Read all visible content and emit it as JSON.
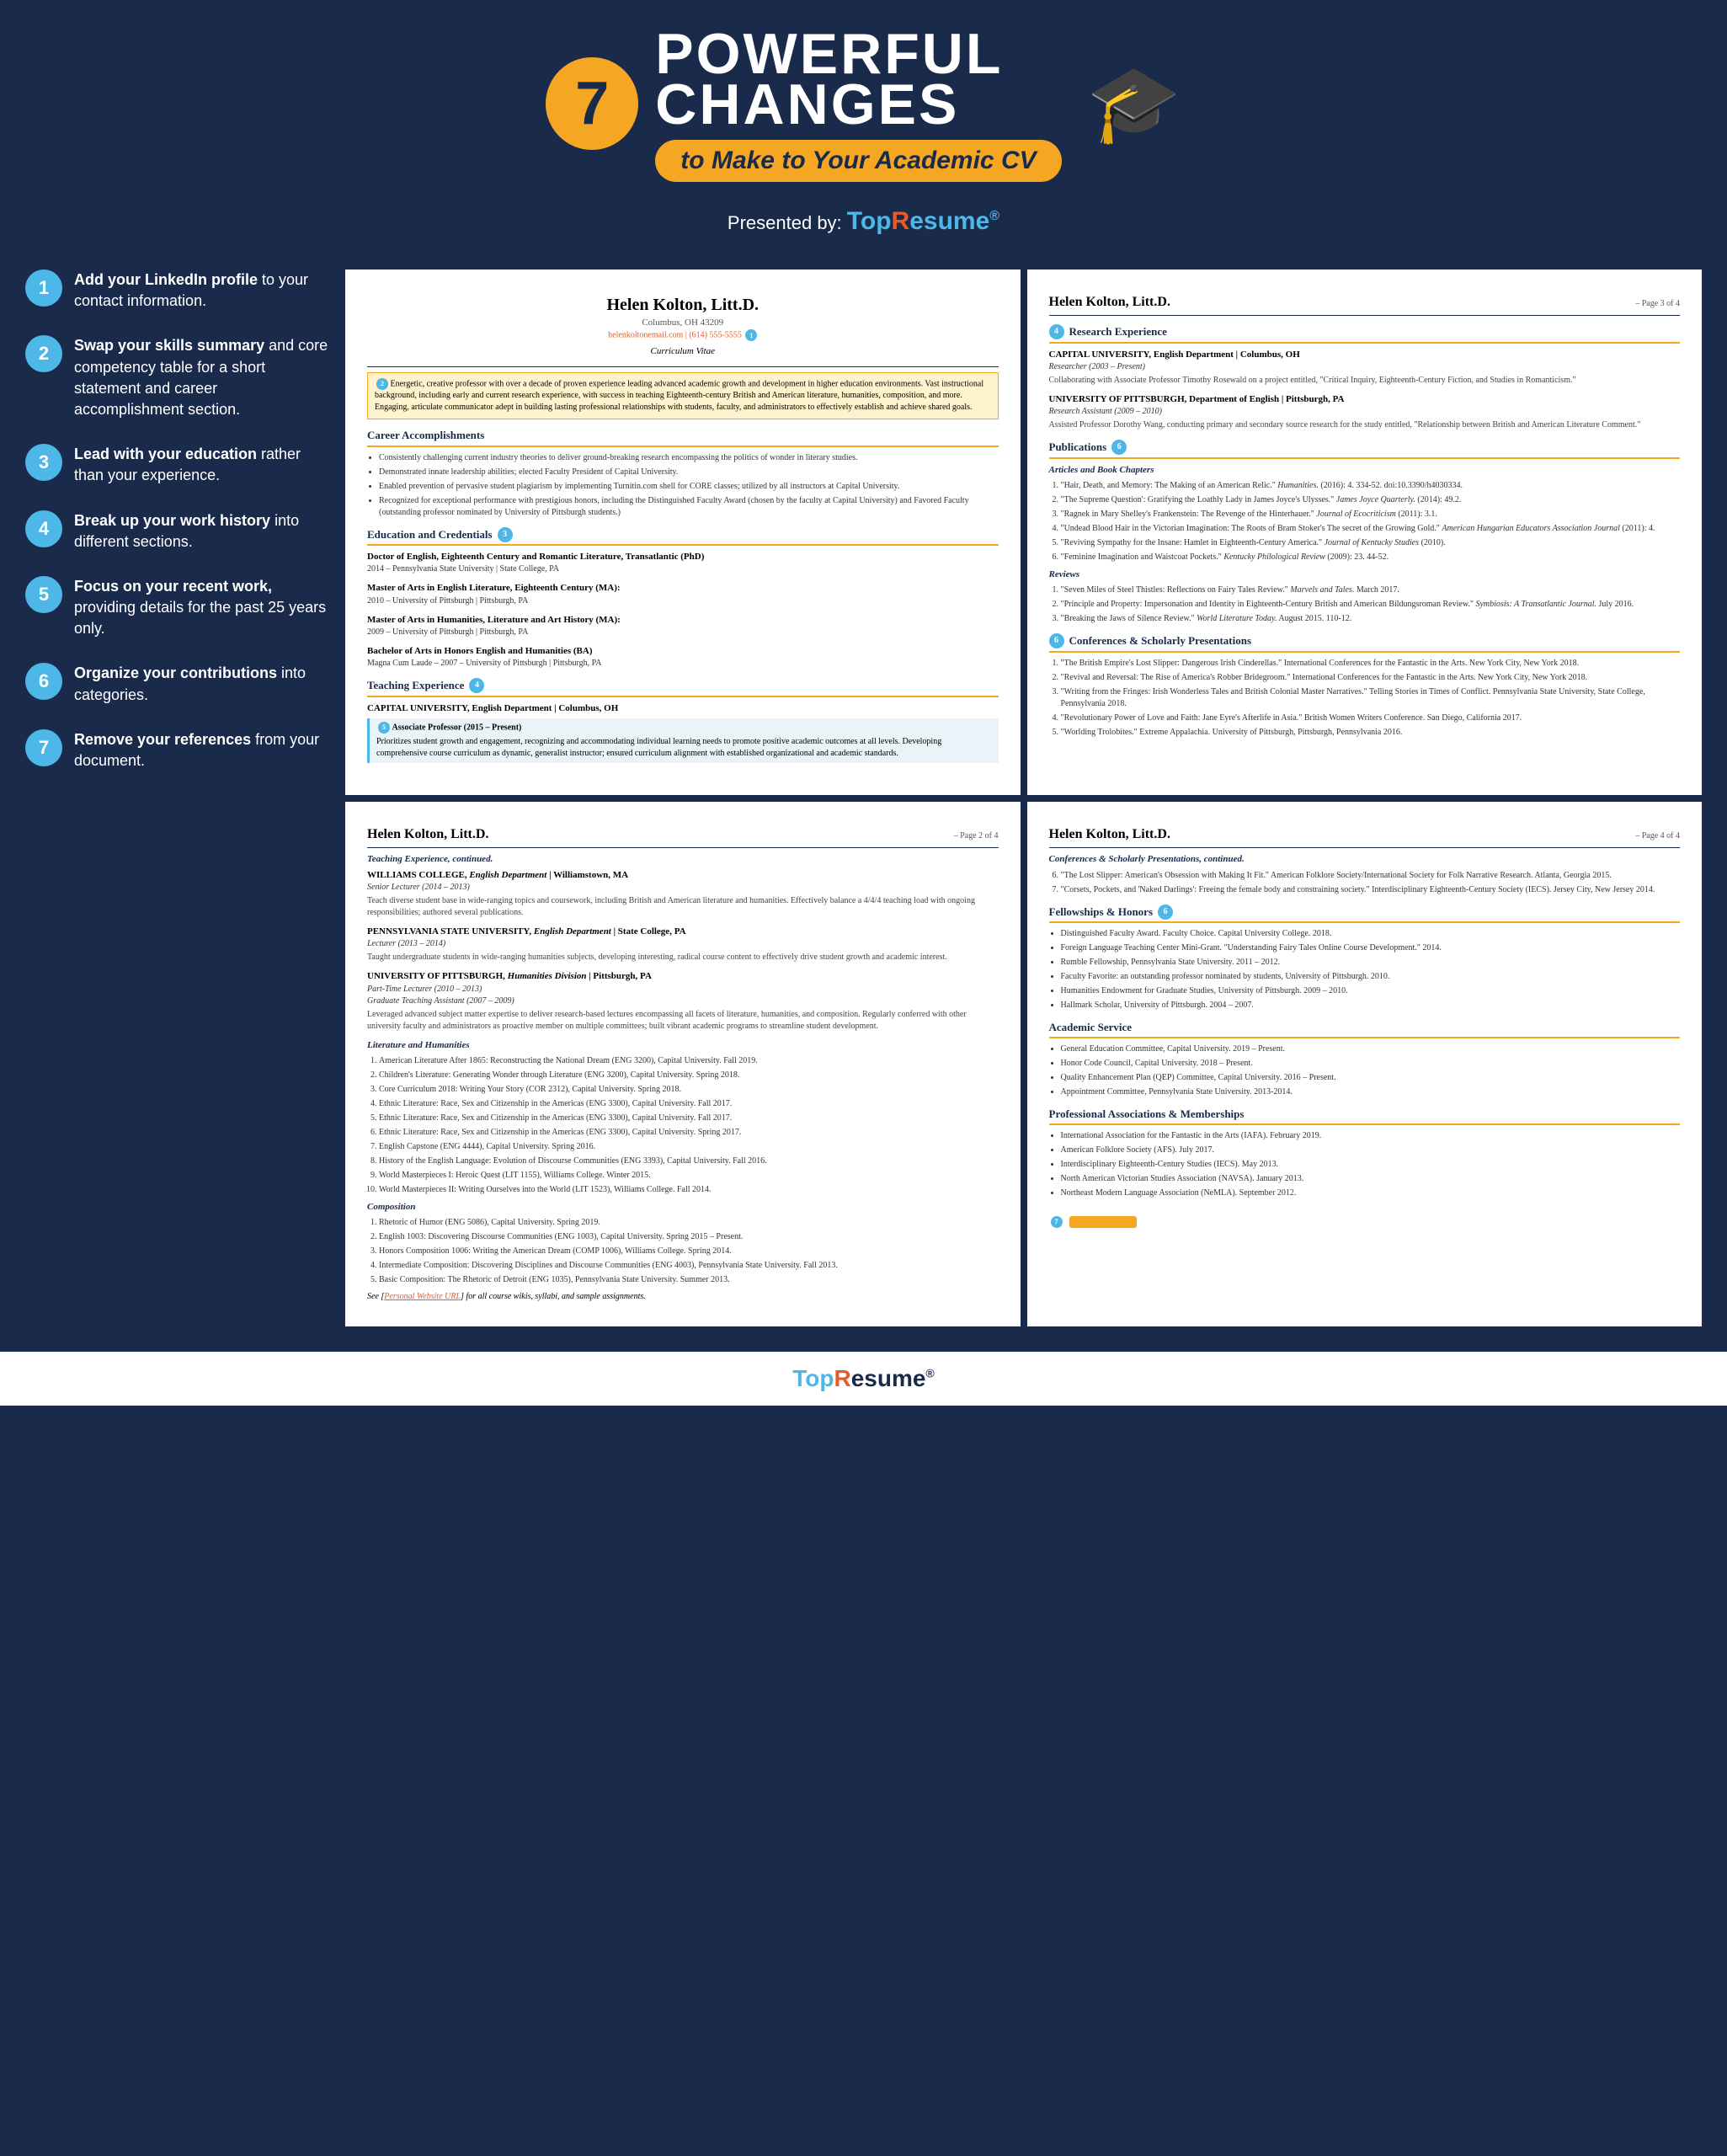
{
  "header": {
    "number": "7",
    "line1": "POWERFUL",
    "line2": "CHANGES",
    "subtitle": "to Make to Your Academic CV",
    "presented_by": "Presented by:",
    "topresume": "TopResume"
  },
  "tips": [
    {
      "number": "1",
      "text_bold": "Add your LinkedIn profile",
      "text_rest": " to your contact information."
    },
    {
      "number": "2",
      "text_bold": "Swap your skills summary",
      "text_rest": " and core competency table for a short statement and career accomplishment section."
    },
    {
      "number": "3",
      "text_bold": "Lead with your education",
      "text_rest": " rather than your experience."
    },
    {
      "number": "4",
      "text_bold": "Break up your work history",
      "text_rest": " into different sections."
    },
    {
      "number": "5",
      "text_bold": "Focus on your recent work,",
      "text_rest": " providing details for the past 25 years only."
    },
    {
      "number": "6",
      "text_bold": "Organize your contributions",
      "text_rest": " into categories."
    },
    {
      "number": "7",
      "text_bold": "Remove your references",
      "text_rest": " from your document."
    }
  ],
  "cv_page1": {
    "name": "Helen Kolton, Litt.D.",
    "location": "Columbus, OH 43209",
    "email": "helenkoltonemail.com",
    "phone": "(614) 555-5555",
    "curricula": "Curriculum Vitae",
    "summary": "Energetic, creative professor with over a decade of proven experience leading advanced academic growth and development in higher education environments. Vast instructional background, including early and current research experience, with success in teaching Eighteenth-century British and American literature, humanities, composition, and more. Engaging, articulate communicator adept in building lasting professional relationships with students, faculty, and administrators to effectively establish and achieve shared goals.",
    "career_section": "Career Accomplishments",
    "accomplishments": [
      "Consistently challenging current industry theories to deliver ground-breaking research encompassing the politics of wonder in literary studies.",
      "Demonstrated innate leadership abilities; elected Faculty President of Capital University.",
      "Enabled prevention of pervasive student plagiarism by implementing Turnitin.com shell for CORE classes; utilized by all instructors at Capital University.",
      "Recognized for exceptional performance with prestigious honors, including the Distinguished Faculty Award (chosen by the faculty at Capital University) and Favored Faculty (outstanding professor nominated by University of Pittsburgh students.)"
    ],
    "education_section": "Education and Credentials",
    "education": [
      {
        "degree": "Doctor of English, Eighteenth Century and Romantic Literature, Transatlantic (PhD)",
        "years": "2014 – Pennsylvania State University | State College, PA"
      },
      {
        "degree": "Master of Arts in English Literature, Eighteenth Century (MA):",
        "years": "2010 – University of Pittsburgh | Pittsburgh, PA"
      },
      {
        "degree": "Master of Arts in Humanities, Literature and Art History (MA):",
        "years": "2009 – University of Pittsburgh | Pittsburgh, PA"
      },
      {
        "degree": "Bachelor of Arts in Honors English and Humanities (BA)",
        "years": "Magna Cum Laude – 2007 – University of Pittsburgh | Pittsburgh, PA"
      }
    ],
    "teaching_section": "Teaching Experience",
    "teaching_entry": {
      "institution": "CAPITAL UNIVERSITY, English Department | Columbus, OH",
      "title": "Associate Professor (2015 – Present)",
      "desc": "Prioritizes student growth and engagement, recognizing and accommodating individual learning needs to promote positive academic outcomes at all levels. Developing comprehensive course curriculum as dynamic, generalist instructor; ensured curriculum alignment with established organizational and academic standards."
    }
  },
  "cv_page2": {
    "name": "Helen Kolton, Litt.D.",
    "page": "– Page 2 of 4",
    "teaching_continued": "Teaching Experience, continued.",
    "positions": [
      {
        "institution": "WILLIAMS COLLEGE, English Department | Williamstown, MA",
        "title": "Senior Lecturer (2014 – 2013)",
        "desc": "Teach diverse student base in wide-ranging topics and coursework, including British and American literature and humanities. Effectively balance a 4/4/4 teaching load with ongoing responsibilities; authored several publications."
      },
      {
        "institution": "PENNSYLVANIA STATE UNIVERSITY, English Department | State College, PA",
        "title": "Lecturer (2013 – 2014)",
        "desc": "Taught undergraduate students in wide-ranging humanities subjects, developing interesting, radical course content to effectively drive student growth and academic interest."
      },
      {
        "institution": "UNIVERSITY OF PITTSBURGH, Humanities Division | Pittsburgh, PA",
        "title": "Part-Time Lecturer (2010 – 2013)",
        "sub_title": "Graduate Teaching Assistant (2007 – 2009)",
        "desc": "Leveraged advanced subject matter expertise to deliver research-based lectures encompassing all facets of literature, humanities, and composition. Regularly conferred with other university faculty and administrators as proactive member on multiple committees; built vibrant academic programs to streamline student development."
      }
    ],
    "lit_section": "Literature and Humanities",
    "lit_courses": [
      "American Literature After 1865: Reconstructing the National Dream (ENG 3200), Capital University. Fall 2019.",
      "Children's Literature: Generating Wonder through Literature (ENG 3200), Capital University. Spring 2018.",
      "Core Curriculum 2018: Writing Your Story (COR 2312), Capital University. Spring 2018.",
      "Ethnic Literature: Race, Sex and Citizenship in the Americas (ENG 3300), Capital University. Fall 2017.",
      "Ethnic Literature: Race, Sex and Citizenship in the Americas (ENG 3300), Capital University. Fall 2017.",
      "Ethnic Literature: Race, Sex and Citizenship in the Americas (ENG 3300), Capital University. Spring 2017.",
      "English Capstone (ENG 4444), Capital University. Spring 2016.",
      "History of the English Language: Evolution of Discourse Communities (ENG 3393), Capital University. Fall 2016.",
      "World Masterpieces I: Heroic Quest (LIT 1155), Williams College. Winter 2015.",
      "World Masterpieces II: Writing Ourselves into the World (LIT 1523), Williams College. Fall 2014."
    ],
    "comp_section": "Composition",
    "comp_courses": [
      "Rhetoric of Humor (ENG 5086), Capital University. Spring 2019.",
      "English 1003: Discovering Discourse Communities (ENG 1003), Capital University. Spring 2015 – Present.",
      "Honors Composition 1006: Writing the American Dream (COMP 1006), Williams College. Spring 2014.",
      "Intermediate Composition: Discovering Disciplines and Discourse Communities (ENG 4003), Pennsylvania State University. Fall 2013.",
      "Basic Composition: The Rhetoric of Detroit (ENG 1035), Pennsylvania State University. Summer 2013."
    ],
    "see_note": "See [Personal Website URL] for all course wikis, syllabi, and sample assignments."
  },
  "cv_page3": {
    "name": "Helen Kolton, Litt.D.",
    "page": "– Page 3 of 4",
    "research_section": "Research Experience",
    "research_entries": [
      {
        "institution": "CAPITAL UNIVERSITY, English Department | Columbus, OH",
        "title": "Researcher (2003 – Present)",
        "desc": "Collaborating with Associate Professor Timothy Rosewald on a project entitled, \"Critical Inquiry, Eighteenth-Century Fiction, and Studies in Romanticism.\""
      },
      {
        "institution": "UNIVERSITY OF PITTSBURGH, Department of English | Pittsburgh, PA",
        "title": "Research Assistant (2009 – 2010)",
        "desc": "Assisted Professor Dorothy Wang, conducting primary and secondary source research for the study entitled, \"Relationship between British and American Literature Comment.\""
      }
    ],
    "pub_section": "Publications",
    "articles_header": "Articles and Book Chapters",
    "articles": [
      "\"Hair, Death, and Memory: The Making of an American Relic.\" Humanities. (2016): 4. 334-52. doi:10.3390/h4030334.",
      "\"The Supreme Question': Gratifying the Loathly Lady in James Joyce's Ulysses.\" James Joyce Quarterly. (2014): 49.2.",
      "\"Ragnek in Mary Shelley's Frankenstein: The Revenge of the Hinterhauer.\" Journal of Ecocriticism (2011): 3.1.",
      "\"Undead Blood Hair in the Victorian Imagination: The Roots of Bram Stoker's The secret of the Growing Gold.\" American Hungarian Educators Association Journal (2011): 4.",
      "\"Reviving Sympathy for the Insane: Hamlet in Eighteenth-Century America.\" Journal of Kentucky Studies (2010).",
      "\"Feminine Imagination and Waistcoat Pockets.\" Kentucky Philological Review (2009): 23. 44-52."
    ],
    "reviews_header": "Reviews",
    "reviews": [
      "\"Seven Miles of Steel Thistles: Reflections on Fairy Tales Review.\" Marvels and Tales. March 2017.",
      "\"Principle and Property: Impersonation and Identity in Eighteenth-Century British and American Bildungsroman Review.\" Symbiosis: A Transatlantic Journal. July 2016.",
      "\"Breaking the Jaws of Silence Review.\" World Literature Today. August 2015. 110-12."
    ],
    "conf_section": "Conferences & Scholarly Presentations",
    "conferences": [
      "\"The British Empire's Lost Slipper: Dangerous Irish Cinderellas.\" International Conferences for the Fantastic in the Arts. New York City, New York 2018.",
      "\"Revival and Reversal: The Rise of America's Robber Bridegroom.\" International Conferences for the Fantastic in the Arts. New York City, New York 2018.",
      "\"Writing from the Fringes: Irish Wonderless Tales and British Colonial Master Narratives.\" Telling Stories in Times of Conflict. Pennsylvania State University, State College, Pennsylvania 2018.",
      "\"Revolutionary Power of Love and Faith: Jane Eyre's Afterlife in Asia.\" British Women Writers Conference. San Diego, California 2017.",
      "\"Worlding Trolobites.\" Extreme Appalachia. University of Pittsburgh, Pittsburgh, Pennsylvania 2016."
    ]
  },
  "cv_page4": {
    "name": "Helen Kolton, Litt.D.",
    "page": "– Page 4 of 4",
    "conf_continued": "Conferences & Scholarly Presentations, continued.",
    "conf_more": [
      "\"The Lost Slipper: American's Obsession with Making It Fit.\" American Folklore Society/International Society for Folk Narrative Research. Atlanta, Georgia 2015.",
      "\"Corsets, Pockets, and 'Naked Darlings': Freeing the female body and constraining society.\" Interdisciplinary Eighteenth-Century Society (IECS). Jersey City, New Jersey 2014."
    ],
    "fellowships_section": "Fellowships & Honors",
    "fellowships": [
      "Distinguished Faculty Award. Faculty Choice. Capital University College. 2018.",
      "Foreign Language Teaching Center Mini-Grant. \"Understanding Fairy Tales Online Course Development.\" 2014.",
      "Rumble Fellowship, Pennsylvania State University. 2011 – 2012.",
      "Faculty Favorite: an outstanding professor nominated by students, University of Pittsburgh. 2010.",
      "Humanities Endowment for Graduate Studies, University of Pittsburgh. 2009 – 2010.",
      "Hallmark Scholar, University of Pittsburgh. 2004 – 2007."
    ],
    "academic_section": "Academic Service",
    "academic_service": [
      "General Education Committee, Capital University. 2019 – Present.",
      "Honor Code Council, Capital University. 2018 – Present.",
      "Quality Enhancement Plan (QEP) Committee, Capital University. 2016 – Present.",
      "Appointment Committee, Pennsylvania State University. 2013-2014."
    ],
    "assoc_section": "Professional Associations & Memberships",
    "associations": [
      "International Association for the Fantastic in the Arts (IAFA). February 2019.",
      "American Folklore Society (AFS). July 2017.",
      "Interdisciplinary Eighteenth-Century Studies (IECS). May 2013.",
      "North American Victorian Studies Association (NAVSA). January 2013.",
      "Northeast Modern Language Association (NeMLA). September 2012."
    ]
  },
  "footer": {
    "logo": "TopResume"
  }
}
